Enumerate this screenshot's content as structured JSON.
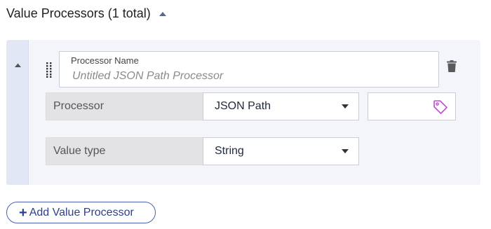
{
  "section": {
    "title": "Value Processors (1 total)"
  },
  "processor": {
    "name_label": "Processor Name",
    "name_placeholder": "Untitled JSON Path Processor",
    "name_value": "",
    "processor_label": "Processor",
    "processor_value": "JSON Path",
    "value_type_label": "Value type",
    "value_type_value": "String"
  },
  "actions": {
    "add_label": "Add Value Processor",
    "add_plus": "+"
  },
  "icons": {
    "collapse": "chevron-up-icon",
    "drag": "drag-handle-icon",
    "delete": "trash-icon",
    "tag": "tag-icon",
    "dropdown": "caret-down-icon"
  },
  "colors": {
    "accent": "#2d3f8f",
    "tag": "#c04bd6",
    "rail": "#e1e7f5"
  }
}
